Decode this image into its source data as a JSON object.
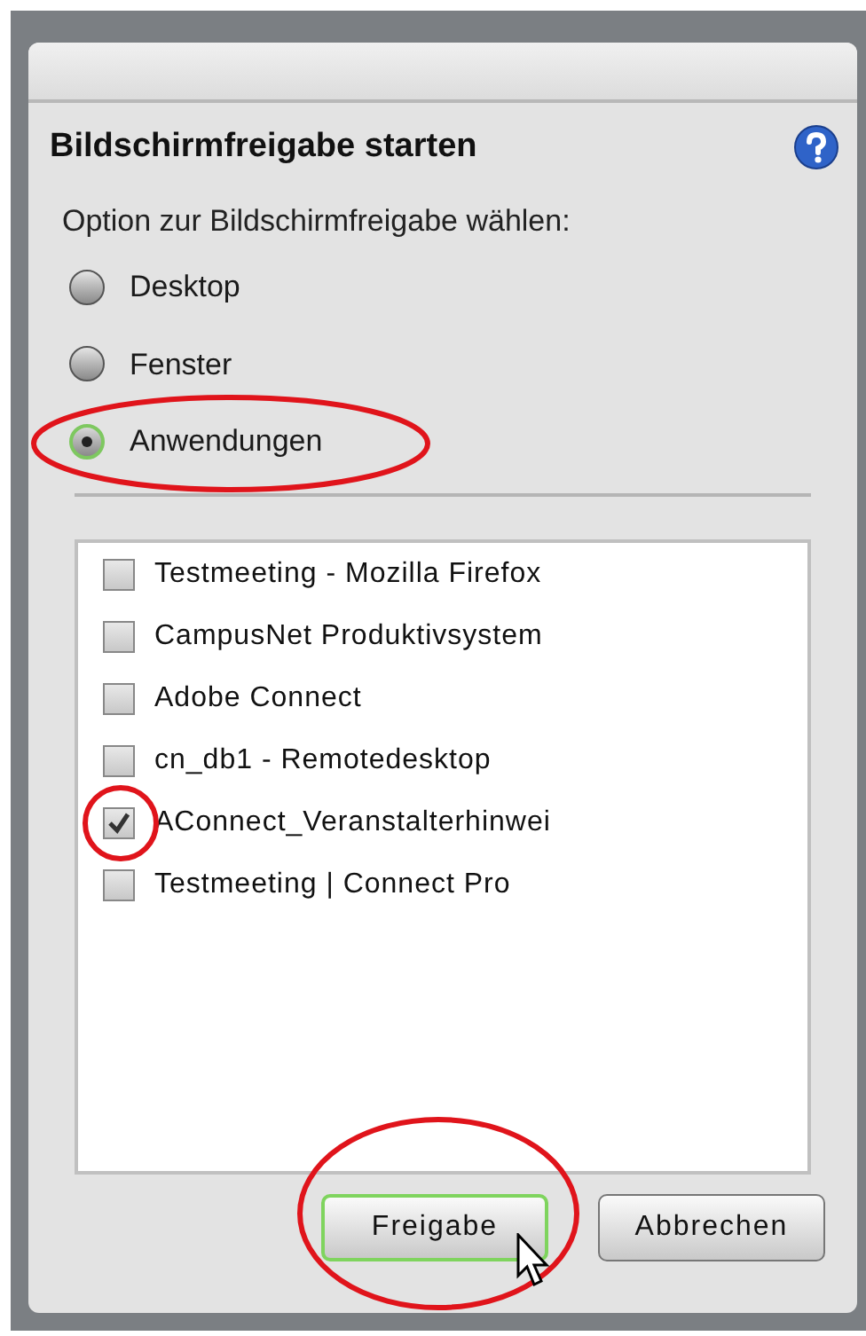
{
  "dialog": {
    "title": "Bildschirmfreigabe starten",
    "prompt": "Option zur Bildschirmfreigabe wählen:"
  },
  "options": [
    {
      "label": "Desktop",
      "selected": false,
      "highlighted": false
    },
    {
      "label": "Fenster",
      "selected": false,
      "highlighted": false
    },
    {
      "label": "Anwendungen",
      "selected": true,
      "highlighted": true
    }
  ],
  "applications": [
    {
      "label": "Testmeeting - Mozilla Firefox",
      "checked": false,
      "highlighted": false
    },
    {
      "label": "CampusNet Produktivsystem",
      "checked": false,
      "highlighted": false
    },
    {
      "label": "Adobe Connect",
      "checked": false,
      "highlighted": false
    },
    {
      "label": "cn_db1 - Remotedesktop",
      "checked": false,
      "highlighted": false
    },
    {
      "label": "AConnect_Veranstalterhinwei",
      "checked": true,
      "highlighted": true
    },
    {
      "label": "Testmeeting | Connect Pro",
      "checked": false,
      "highlighted": false
    }
  ],
  "buttons": [
    {
      "label": "Freigabe",
      "highlighted": true,
      "hovered": true
    },
    {
      "label": "Abbrechen",
      "highlighted": false,
      "hovered": false
    }
  ]
}
